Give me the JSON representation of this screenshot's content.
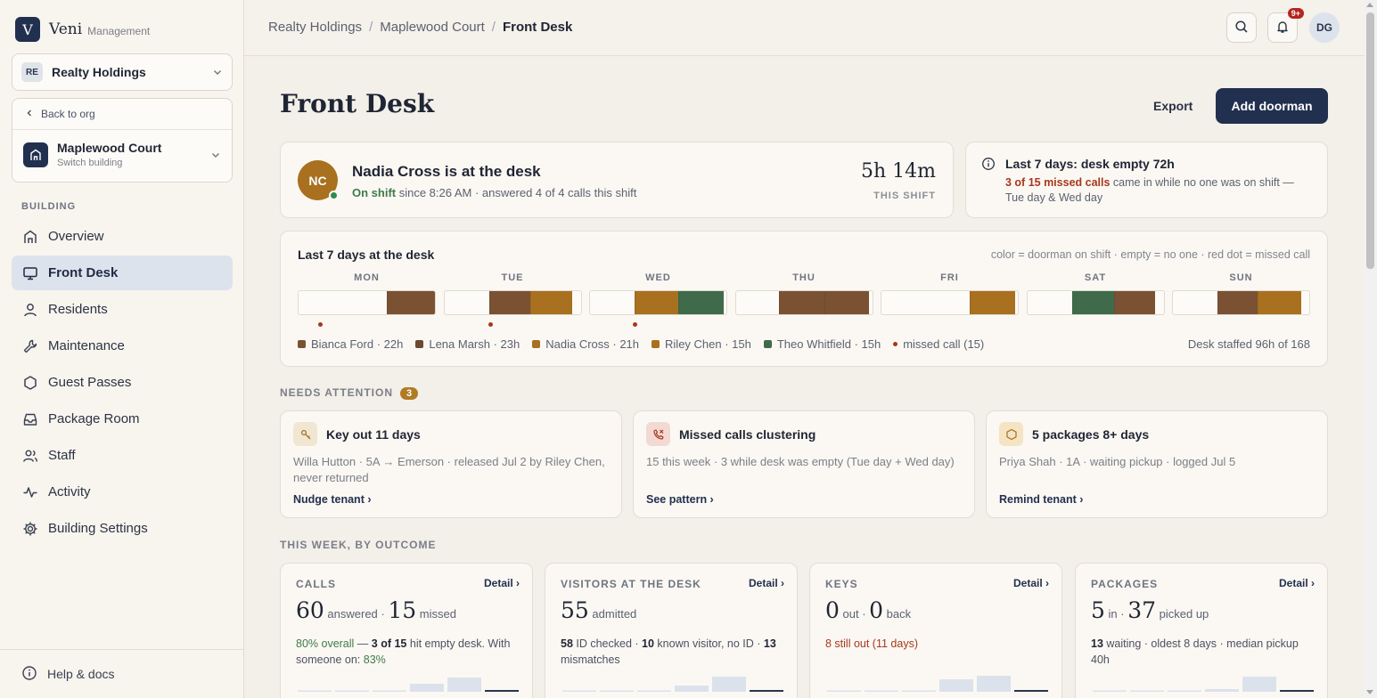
{
  "app": {
    "logo_letter": "V",
    "name": "Veni",
    "subtitle": "Management"
  },
  "org": {
    "badge": "RE",
    "name": "Realty Holdings"
  },
  "building": {
    "back_label": "Back to org",
    "name": "Maplewood Court",
    "sub": "Switch building"
  },
  "nav": {
    "section": "BUILDING",
    "items": [
      {
        "label": "Overview",
        "icon": "building-icon"
      },
      {
        "label": "Front Desk",
        "icon": "monitor-icon",
        "active": true
      },
      {
        "label": "Residents",
        "icon": "person-icon"
      },
      {
        "label": "Maintenance",
        "icon": "wrench-icon"
      },
      {
        "label": "Guest Passes",
        "icon": "hexagon-icon"
      },
      {
        "label": "Package Room",
        "icon": "inbox-icon"
      },
      {
        "label": "Staff",
        "icon": "users-icon"
      },
      {
        "label": "Activity",
        "icon": "pulse-icon"
      },
      {
        "label": "Building Settings",
        "icon": "gear-icon"
      }
    ],
    "help": "Help & docs"
  },
  "topbar": {
    "breadcrumbs": [
      "Realty Holdings",
      "Maplewood Court",
      "Front Desk"
    ],
    "notif_badge": "9+",
    "avatar": "DG"
  },
  "page": {
    "title": "Front Desk",
    "export": "Export",
    "add": "Add doorman"
  },
  "shift": {
    "initials": "NC",
    "title": "Nadia Cross is at the desk",
    "status": "On shift",
    "detail": " since 8:26 AM · answered 4 of 4 calls this shift",
    "duration": "5h 14m",
    "duration_label": "THIS SHIFT"
  },
  "empty": {
    "title": "Last 7 days: desk empty 72h",
    "highlight": "3 of 15 missed calls",
    "rest": " came in while no one was on shift — Tue day & Wed day"
  },
  "week": {
    "title": "Last 7 days at the desk",
    "note": "color = doorman on shift · empty = no one · red dot = missed call",
    "days": [
      {
        "name": "MON",
        "segs": [
          {
            "s": 0.65,
            "e": 1.0,
            "c": "#7a5233"
          }
        ],
        "dots": [
          0.16
        ]
      },
      {
        "name": "TUE",
        "segs": [
          {
            "s": 0.33,
            "e": 0.63,
            "c": "#7a5233"
          },
          {
            "s": 0.63,
            "e": 0.94,
            "c": "#a8701f"
          }
        ],
        "dots": [
          0.34
        ]
      },
      {
        "name": "WED",
        "segs": [
          {
            "s": 0.33,
            "e": 0.65,
            "c": "#a8701f"
          },
          {
            "s": 0.65,
            "e": 0.98,
            "c": "#3f6b4a"
          }
        ],
        "dots": [
          0.33
        ]
      },
      {
        "name": "THU",
        "segs": [
          {
            "s": 0.32,
            "e": 0.65,
            "c": "#7a5233"
          },
          {
            "s": 0.65,
            "e": 0.98,
            "c": "#7a5233"
          }
        ],
        "dots": []
      },
      {
        "name": "FRI",
        "segs": [
          {
            "s": 0.65,
            "e": 0.98,
            "c": "#a8701f"
          }
        ],
        "dots": []
      },
      {
        "name": "SAT",
        "segs": [
          {
            "s": 0.33,
            "e": 0.64,
            "c": "#3f6b4a"
          },
          {
            "s": 0.64,
            "e": 0.94,
            "c": "#7a5233"
          }
        ],
        "dots": []
      },
      {
        "name": "SUN",
        "segs": [
          {
            "s": 0.33,
            "e": 0.62,
            "c": "#7a5233"
          },
          {
            "s": 0.62,
            "e": 0.94,
            "c": "#a8701f"
          }
        ],
        "dots": []
      }
    ],
    "legend": [
      {
        "label": "Bianca Ford · 22h",
        "color": "#7a5233"
      },
      {
        "label": "Lena Marsh · 23h",
        "color": "#6b4a2e"
      },
      {
        "label": "Nadia Cross · 21h",
        "color": "#a8701f"
      },
      {
        "label": "Riley Chen · 15h",
        "color": "#a8701f"
      },
      {
        "label": "Theo Whitfield · 15h",
        "color": "#3f6b4a"
      }
    ],
    "missed_legend": "missed call (15)",
    "staffed": "Desk staffed 96h of 168"
  },
  "attention": {
    "heading": "NEEDS ATTENTION",
    "count": "3",
    "items": [
      {
        "title": "Key out 11 days",
        "text": "Willa Hutton · 5A → Emerson · released Jul 2 by Riley Chen, never returned",
        "link": "Nudge tenant ›",
        "icon": "key-icon",
        "icon_bg": "#f1e6d2"
      },
      {
        "title": "Missed calls clustering",
        "text": "15 this week · 3 while desk was empty (Tue day + Wed day)",
        "link": "See pattern ›",
        "icon": "phone-missed-icon",
        "icon_bg": "#f3d9d3"
      },
      {
        "title": "5 packages 8+ days",
        "text": "Priya Shah · 1A · waiting pickup · logged Jul 5",
        "link": "Remind tenant ›",
        "icon": "package-icon",
        "icon_bg": "#f4e4c4"
      }
    ]
  },
  "outcome": {
    "heading": "THIS WEEK, BY OUTCOME",
    "detail": "Detail ›",
    "calls": {
      "label": "CALLS",
      "n1": "60",
      "u1": " answered · ",
      "n2": "15",
      "u2": " missed",
      "green": "80% overall",
      "mid1": " — ",
      "b1": "3 of 15",
      "mid2": " hit empty desk. With someone on: ",
      "green2": "83%",
      "spark": [
        0.05,
        0.05,
        0.05,
        0.45,
        0.8,
        0.1
      ]
    },
    "visitors": {
      "label": "VISITORS AT THE DESK",
      "n1": "55",
      "u1": " admitted",
      "b1": "58",
      "t1": " ID checked · ",
      "b2": "10",
      "t2": " known visitor, no ID · ",
      "b3": "13",
      "t3": " mismatches",
      "spark": [
        0.05,
        0.05,
        0.05,
        0.35,
        0.85,
        0.1
      ]
    },
    "keys": {
      "label": "KEYS",
      "n1": "0",
      "u1": " out · ",
      "n2": "0",
      "u2": " back",
      "red": "8 still out (11 days)",
      "spark": [
        0.05,
        0.05,
        0.05,
        0.7,
        0.9,
        0.1
      ]
    },
    "packages": {
      "label": "PACKAGES",
      "n1": "5",
      "u1": " in · ",
      "n2": "37",
      "u2": " picked up",
      "b1": "13",
      "t1": " waiting · oldest 8 days · median pickup 40h",
      "spark": [
        0.05,
        0.05,
        0.05,
        0.15,
        0.85,
        0.1
      ]
    }
  }
}
